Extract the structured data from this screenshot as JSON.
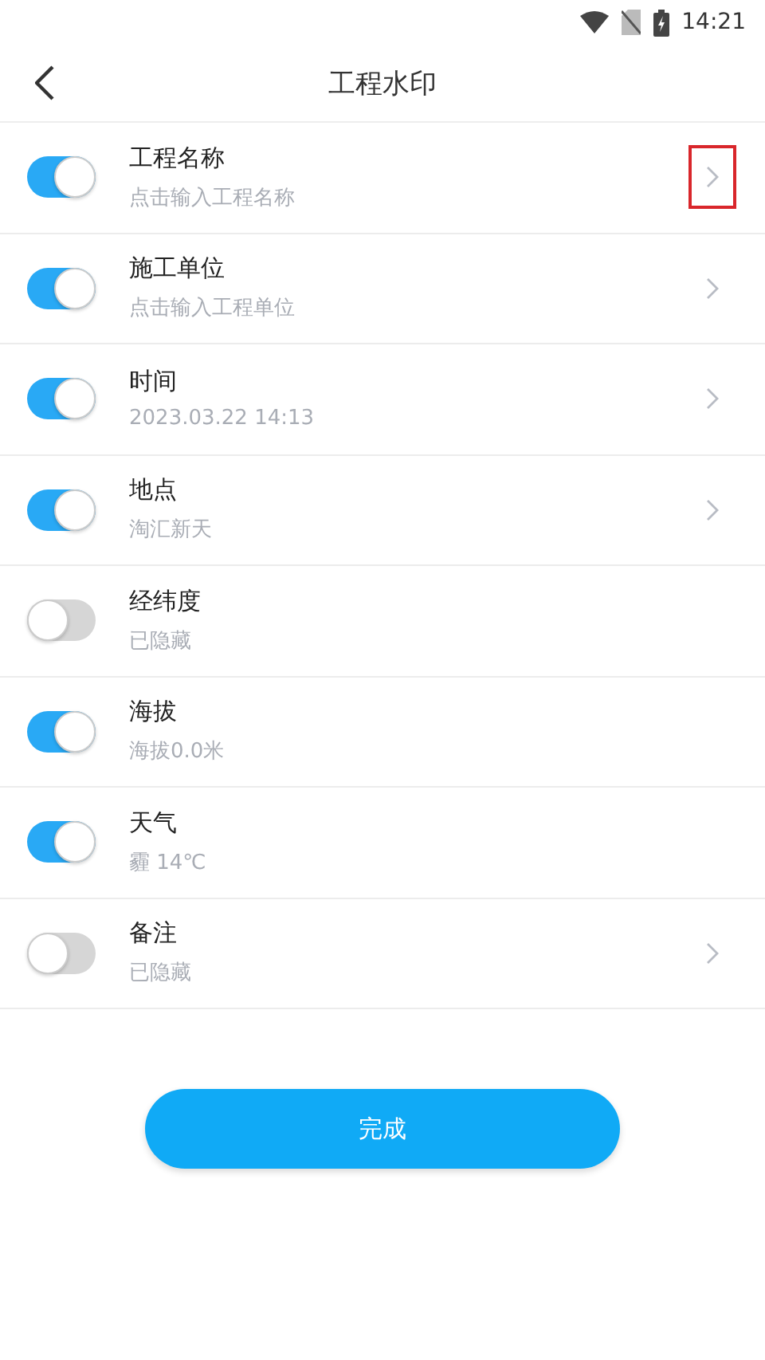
{
  "status_bar": {
    "time": "14:21"
  },
  "header": {
    "title": "工程水印"
  },
  "items": [
    {
      "label": "工程名称",
      "value": "点击输入工程名称",
      "on": true,
      "chevron": true,
      "highlighted": true
    },
    {
      "label": "施工单位",
      "value": "点击输入工程单位",
      "on": true,
      "chevron": true,
      "highlighted": false
    },
    {
      "label": "时间",
      "value": "2023.03.22 14:13",
      "on": true,
      "chevron": true,
      "highlighted": false
    },
    {
      "label": "地点",
      "value": "淘汇新天",
      "on": true,
      "chevron": true,
      "highlighted": false
    },
    {
      "label": "经纬度",
      "value": "已隐藏",
      "on": false,
      "chevron": false,
      "highlighted": false
    },
    {
      "label": "海拔",
      "value": "海拔0.0米",
      "on": true,
      "chevron": false,
      "highlighted": false
    },
    {
      "label": "天气",
      "value": "霾 14℃",
      "on": true,
      "chevron": false,
      "highlighted": false
    },
    {
      "label": "备注",
      "value": "已隐藏",
      "on": false,
      "chevron": true,
      "highlighted": false
    }
  ],
  "done_button": "完成"
}
